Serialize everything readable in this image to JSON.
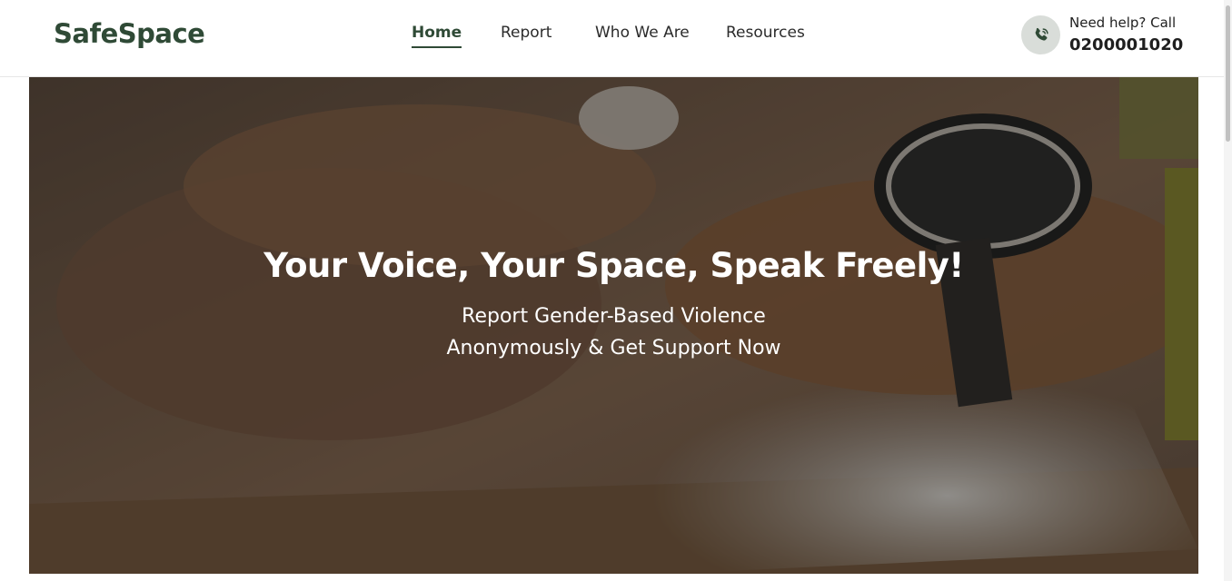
{
  "brand": {
    "logo": "SafeSpace",
    "color": "#2f4a36"
  },
  "nav": {
    "items": [
      {
        "label": "Home",
        "active": true
      },
      {
        "label": "Report",
        "active": false
      },
      {
        "label": "Who We Are",
        "active": false
      },
      {
        "label": "Resources",
        "active": false
      }
    ]
  },
  "help": {
    "label": "Need help? Call",
    "number": "0200001020",
    "icon": "phone-icon"
  },
  "hero": {
    "title": "Your Voice, Your Space, Speak Freely!",
    "subtitle_line1": "Report Gender-Based Violence",
    "subtitle_line2": "Anonymously & Get Support Now",
    "image": "hands-and-wristwatch-photo"
  }
}
